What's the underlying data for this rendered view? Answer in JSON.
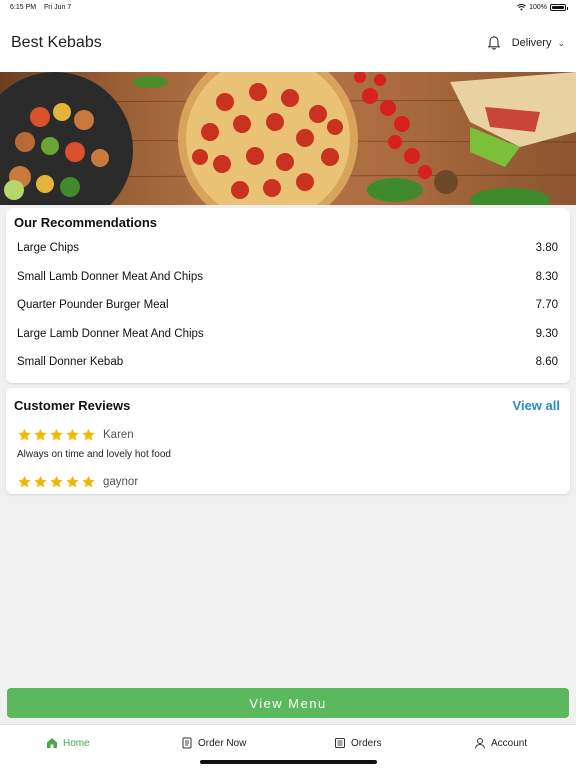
{
  "status_bar": {
    "time": "6:15 PM",
    "date": "Fri Jun 7",
    "battery": "100%",
    "battery_level": 1.0
  },
  "header": {
    "title": "Best Kebabs",
    "mode": "Delivery"
  },
  "recommendations": {
    "title": "Our Recommendations",
    "items": [
      {
        "name": "Large Chips",
        "price": "3.80"
      },
      {
        "name": "Small Lamb Donner Meat And Chips",
        "price": "8.30"
      },
      {
        "name": "Quarter Pounder Burger Meal",
        "price": "7.70"
      },
      {
        "name": "Large Lamb Donner Meat And Chips",
        "price": "9.30"
      },
      {
        "name": "Small Donner Kebab",
        "price": "8.60"
      }
    ]
  },
  "reviews": {
    "title": "Customer Reviews",
    "view_all": "View all",
    "items": [
      {
        "name": "Karen",
        "rating": 5,
        "text": "Always on time and lovely hot food"
      },
      {
        "name": "gaynor",
        "rating": 5,
        "text": ""
      }
    ]
  },
  "view_menu_label": "View Menu",
  "tabs": [
    {
      "label": "Home",
      "icon": "home-icon",
      "active": true
    },
    {
      "label": "Order Now",
      "icon": "order-icon",
      "active": false
    },
    {
      "label": "Orders",
      "icon": "receipt-icon",
      "active": false
    },
    {
      "label": "Account",
      "icon": "user-icon",
      "active": false
    }
  ],
  "colors": {
    "accent_green": "#5cb85c",
    "link_blue": "#2a8bc4",
    "star_yellow": "#f5b800"
  }
}
